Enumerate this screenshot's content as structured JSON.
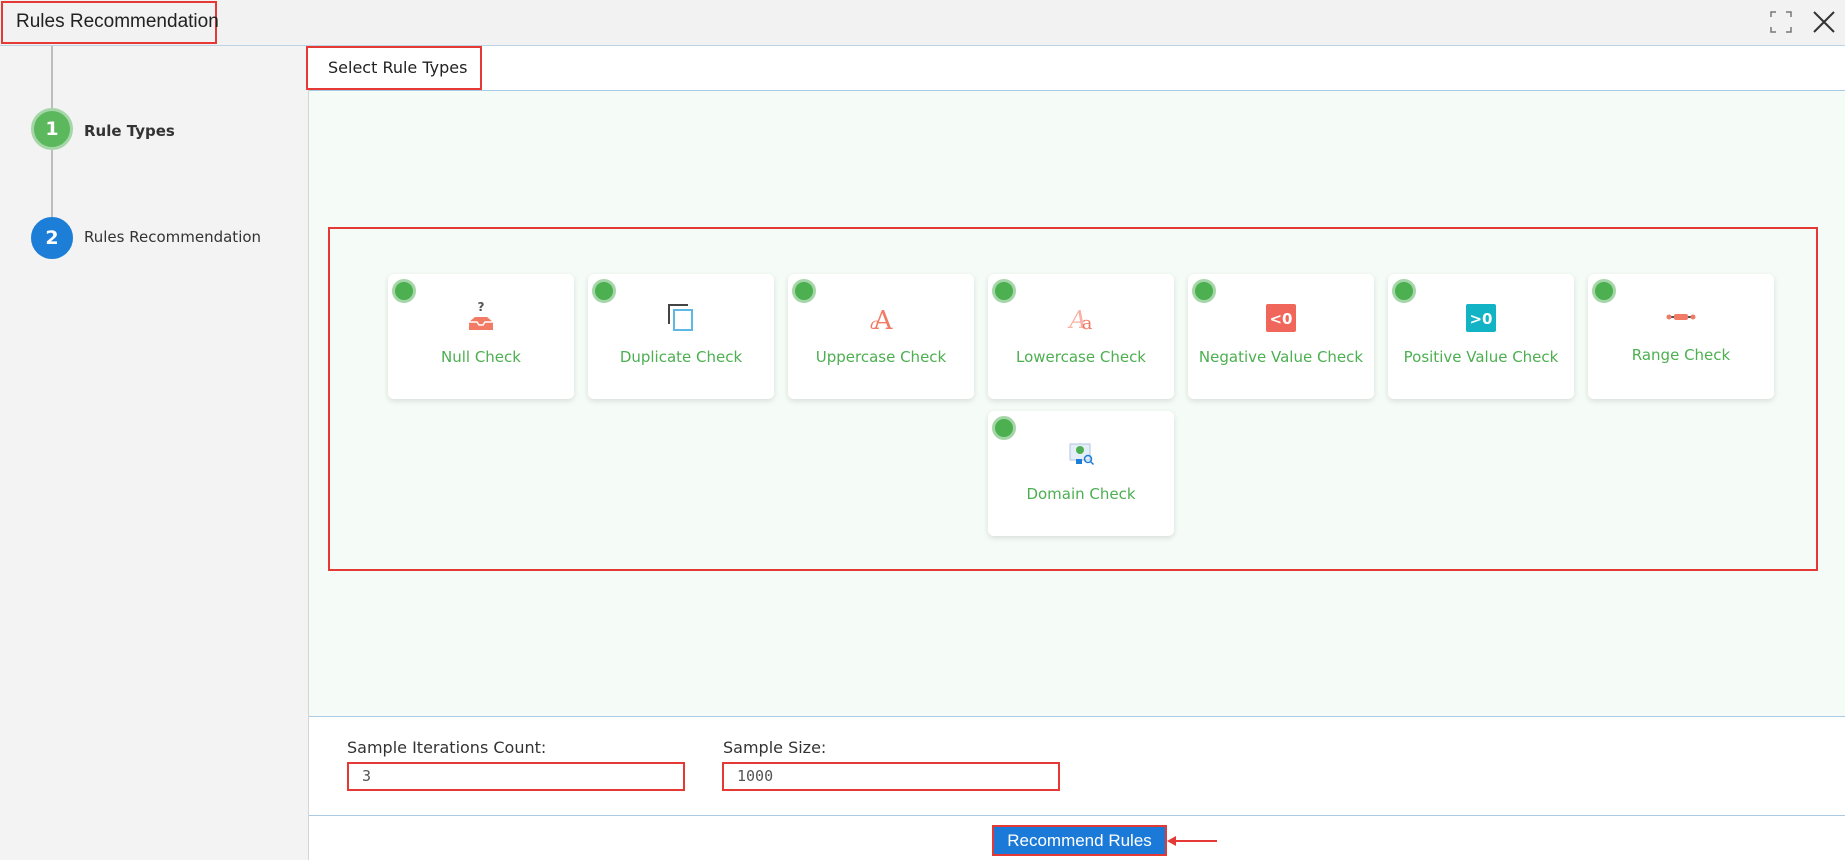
{
  "window": {
    "title": "Rules Recommendation"
  },
  "steps": [
    {
      "number": "1",
      "label": "Rule Types"
    },
    {
      "number": "2",
      "label": "Rules Recommendation"
    }
  ],
  "section_title": "Select Rule Types",
  "rule_types": [
    {
      "label": "Null Check",
      "icon": "inbox-question-icon",
      "selected": true
    },
    {
      "label": "Duplicate Check",
      "icon": "duplicate-icon",
      "selected": true
    },
    {
      "label": "Uppercase Check",
      "icon": "uppercase-icon",
      "selected": true
    },
    {
      "label": "Lowercase Check",
      "icon": "lowercase-icon",
      "selected": true
    },
    {
      "label": "Negative Value Check",
      "icon": "less-than-zero-icon",
      "selected": true
    },
    {
      "label": "Positive Value Check",
      "icon": "greater-than-zero-icon",
      "selected": true
    },
    {
      "label": "Range Check",
      "icon": "range-icon",
      "selected": true
    },
    {
      "label": "Domain Check",
      "icon": "domain-search-icon",
      "selected": true
    }
  ],
  "fields": {
    "iterations": {
      "label": "Sample Iterations Count:",
      "value": "3"
    },
    "sample_size": {
      "label": "Sample Size:",
      "value": "1000"
    }
  },
  "actions": {
    "recommend": "Recommend Rules"
  },
  "icons": {
    "neg": "<0",
    "pos": ">0",
    "upper": "A",
    "lower": "a"
  },
  "colors": {
    "accent_blue": "#1b7ad8",
    "check_green": "#4caf50",
    "annotation_red": "#e53935"
  }
}
